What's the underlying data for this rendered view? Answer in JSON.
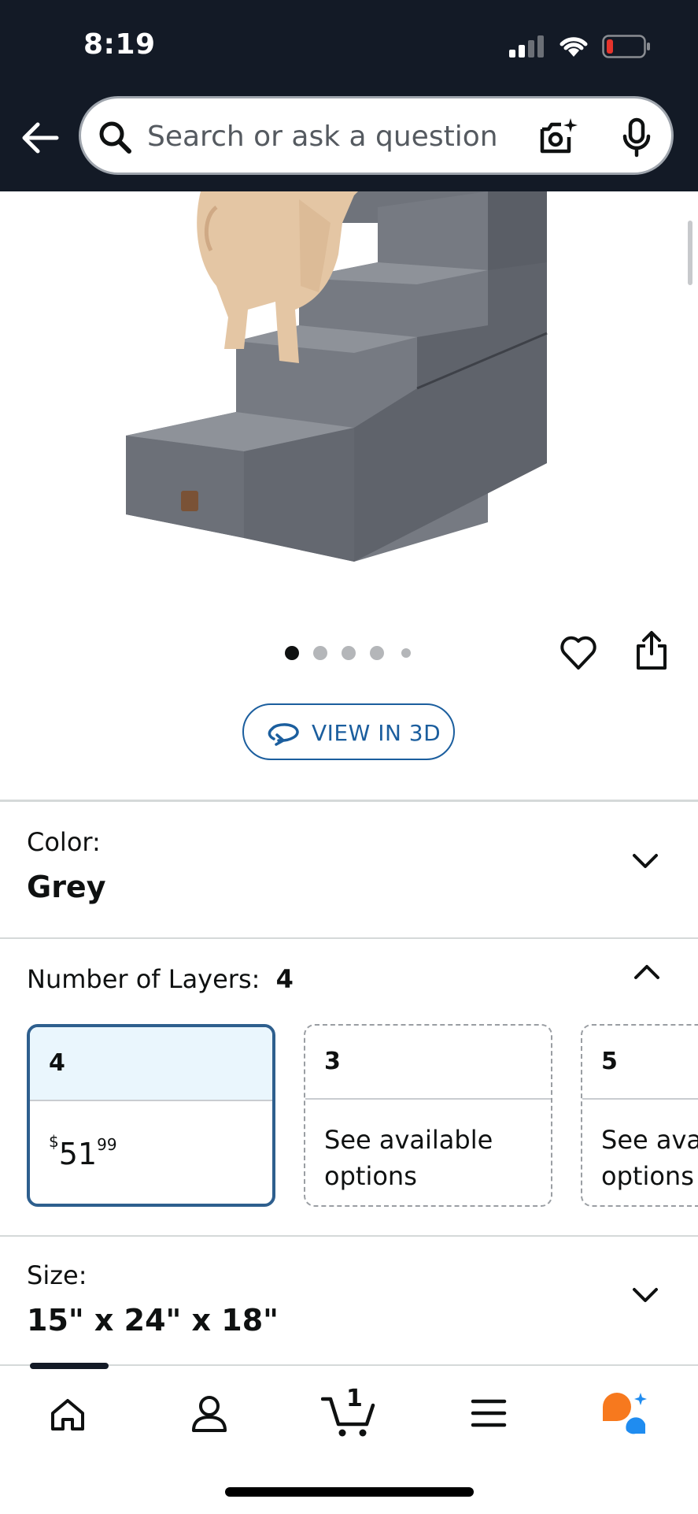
{
  "status_bar": {
    "time": "8:19"
  },
  "search": {
    "placeholder": "Search or ask a question"
  },
  "carousel": {
    "total_images": 5,
    "active_index": 0
  },
  "view_in_3d": {
    "label": "VIEW IN 3D"
  },
  "color_section": {
    "label": "Color:",
    "value": "Grey"
  },
  "layers_section": {
    "label": "Number of Layers:",
    "value": "4",
    "options": [
      {
        "title": "4",
        "price_symbol": "$",
        "price_whole": "51",
        "price_fraction": "99",
        "selected": true
      },
      {
        "title": "3",
        "availability_line1": "See available",
        "availability_line2": "options",
        "selected": false
      },
      {
        "title": "5",
        "availability_line1": "See available",
        "availability_line2": "options",
        "selected": false
      }
    ]
  },
  "size_section": {
    "label": "Size:",
    "value": "15\" x 24\" x 18\""
  },
  "bottom_nav": {
    "items": [
      "home",
      "account",
      "cart",
      "menu",
      "rufus-ai"
    ],
    "cart_count": "1",
    "active": "home"
  },
  "colors": {
    "header_bg": "#131a26",
    "link_blue": "#1b5e9e",
    "selected_border": "#2e5f8e",
    "selected_tint": "#eaf6fd",
    "ai_orange": "#f7791e",
    "ai_blue": "#1f8cf0"
  }
}
